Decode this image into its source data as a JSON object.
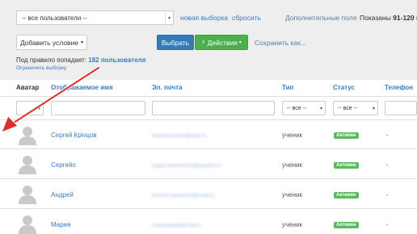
{
  "toolbar": {
    "user_filter": "-- все пользователи --",
    "new_selection": "новая выборка",
    "reset": "сбросить",
    "extra_fields": "Дополнительные поля",
    "shown_prefix": "Показаны ",
    "shown_range": "91-120",
    "shown_suffix": " из"
  },
  "actions": {
    "add_condition": "Добавить условие",
    "select": "Выбрать",
    "actions": "Действия",
    "save_as": "Сохранить как..."
  },
  "rule": {
    "prefix": "Под правило попадает: ",
    "count": "182 пользователя",
    "limit_link": "Ограничить выборку"
  },
  "table": {
    "columns": [
      "Аватар",
      "Отображаемое имя",
      "Эл. почта",
      "Тип",
      "Статус",
      "Телефон"
    ],
    "filters": {
      "type": "-- все --",
      "status": "-- все --"
    },
    "rows": [
      {
        "name": "Сергей Крivцов",
        "email": "sharetecruiser@mail.ru",
        "type": "ученик",
        "status": "Активен",
        "phone": "-"
      },
      {
        "name": "Сергейо",
        "email": "sugar-writerhome@yandex.ru",
        "type": "ученик",
        "status": "Активен",
        "phone": "-"
      },
      {
        "name": "Андрей",
        "email": "kroman-andruxaa@mail.ru",
        "type": "ученик",
        "status": "Активен",
        "phone": "-"
      },
      {
        "name": "Мария",
        "email": "mariacasaw@mail.ru",
        "type": "ученик",
        "status": "Активен",
        "phone": "-"
      }
    ]
  },
  "colors": {
    "accent": "#337ab7",
    "success": "#5cb85c",
    "arrow": "#d9302b"
  }
}
